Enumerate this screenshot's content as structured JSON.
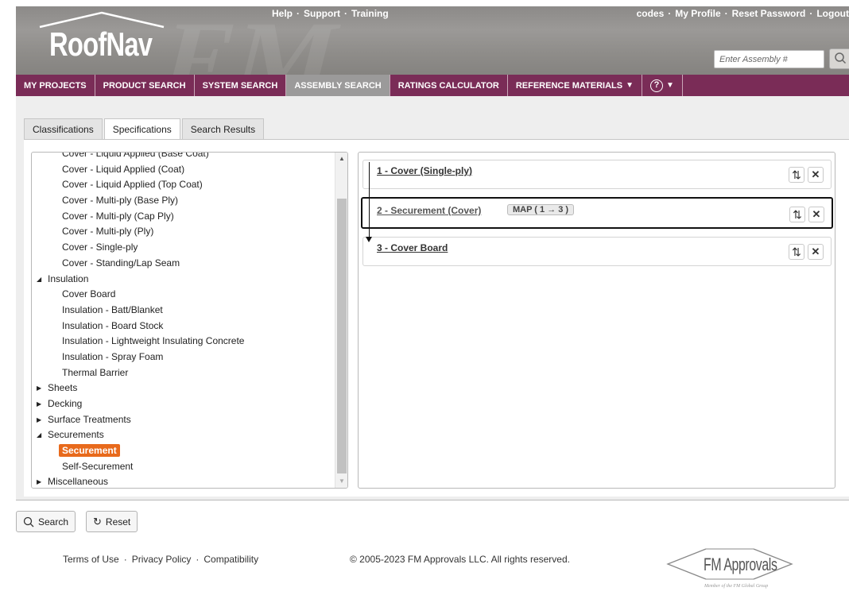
{
  "header": {
    "logo_text": "RoofNav",
    "top_links": [
      "Help",
      "Support",
      "Training"
    ],
    "user_links": [
      "codes",
      "My Profile",
      "Reset Password",
      "Logout"
    ],
    "assembly_placeholder": "Enter Assembly #",
    "brand_color": "#7a2c57"
  },
  "nav": {
    "items": [
      "MY PROJECTS",
      "PRODUCT SEARCH",
      "SYSTEM SEARCH",
      "ASSEMBLY SEARCH",
      "RATINGS CALCULATOR",
      "REFERENCE MATERIALS"
    ],
    "active": "ASSEMBLY SEARCH"
  },
  "tabs": [
    "Classifications",
    "Specifications",
    "Search Results"
  ],
  "active_tab": "Specifications",
  "tree": {
    "clipped_top": "Cover - Liquid Applied (Base Coat)",
    "rows": [
      {
        "label": "Cover - Liquid Applied (Coat)",
        "level": "child"
      },
      {
        "label": "Cover - Liquid Applied (Top Coat)",
        "level": "child"
      },
      {
        "label": "Cover - Multi-ply (Base Ply)",
        "level": "child"
      },
      {
        "label": "Cover - Multi-ply (Cap Ply)",
        "level": "child"
      },
      {
        "label": "Cover - Multi-ply (Ply)",
        "level": "child"
      },
      {
        "label": "Cover - Single-ply",
        "level": "child"
      },
      {
        "label": "Cover - Standing/Lap Seam",
        "level": "child"
      },
      {
        "label": "Insulation",
        "level": "parent",
        "expanded": true
      },
      {
        "label": "Cover Board",
        "level": "child"
      },
      {
        "label": "Insulation - Batt/Blanket",
        "level": "child"
      },
      {
        "label": "Insulation - Board Stock",
        "level": "child"
      },
      {
        "label": "Insulation - Lightweight Insulating Concrete",
        "level": "child"
      },
      {
        "label": "Insulation - Spray Foam",
        "level": "child"
      },
      {
        "label": "Thermal Barrier",
        "level": "child"
      },
      {
        "label": "Sheets",
        "level": "parent",
        "expanded": false
      },
      {
        "label": "Decking",
        "level": "parent",
        "expanded": false
      },
      {
        "label": "Surface Treatments",
        "level": "parent",
        "expanded": false
      },
      {
        "label": "Securements",
        "level": "parent",
        "expanded": true
      },
      {
        "label": "Securement",
        "level": "child",
        "selected": true
      },
      {
        "label": "Self-Securement",
        "level": "child"
      },
      {
        "label": "Miscellaneous",
        "level": "parent",
        "expanded": false
      }
    ]
  },
  "assembly": {
    "layers": [
      {
        "title": "1 - Cover (Single-ply)"
      },
      {
        "title": "2 - Securement (Cover)",
        "badge": "MAP ( 1 → 3 )",
        "highlighted": true
      },
      {
        "title": "3 - Cover Board"
      }
    ]
  },
  "buttons": {
    "search": "Search",
    "reset": "Reset"
  },
  "footer": {
    "links": [
      "Terms of Use",
      "Privacy Policy",
      "Compatibility"
    ],
    "copyright": "© 2005-2023 FM Approvals LLC. All rights reserved.",
    "logo_text": "FM Approvals",
    "logo_sub": "Member of the FM Global Group"
  }
}
